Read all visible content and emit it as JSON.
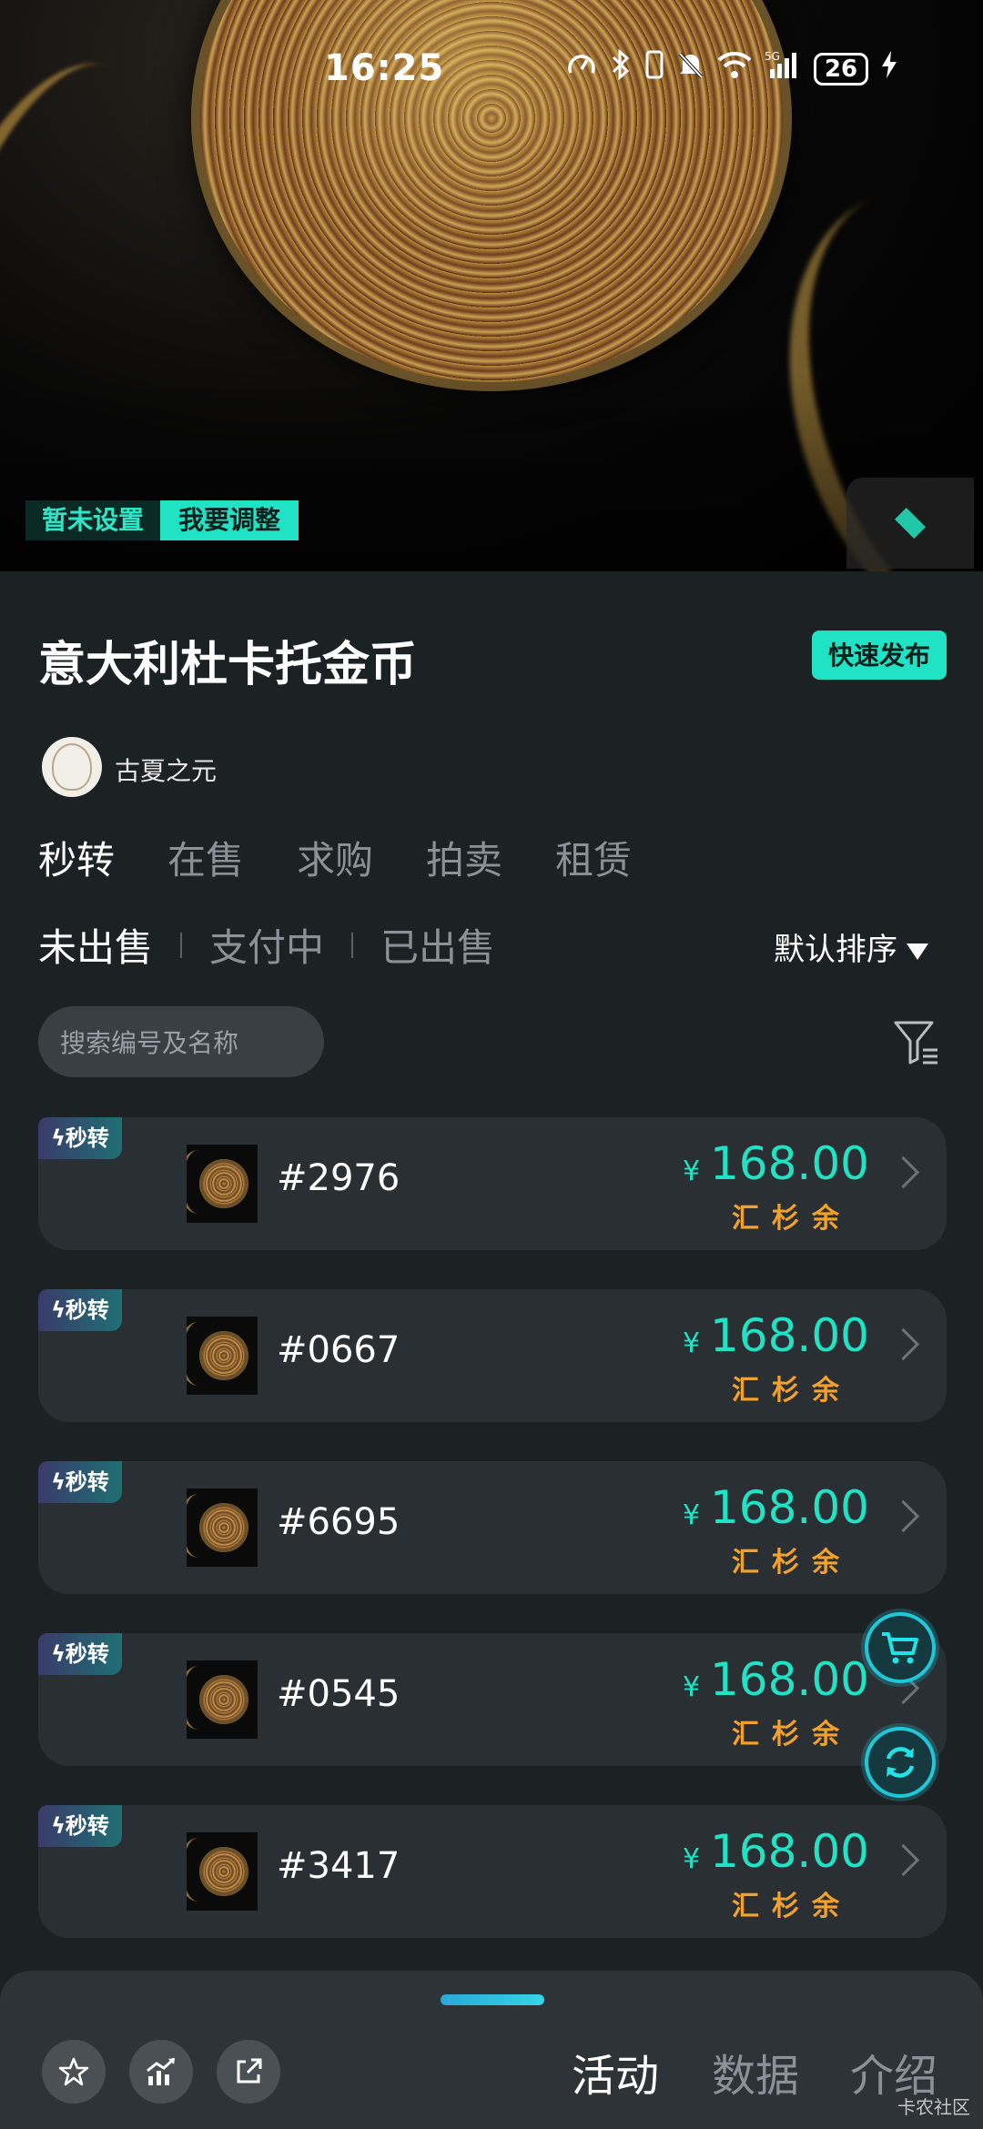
{
  "status_bar": {
    "time": "16:25",
    "network": "5G",
    "battery": "26"
  },
  "hero": {
    "tag_unset": "暂未设置",
    "tag_adjust": "我要调整"
  },
  "header": {
    "title": "意大利杜卡托金币",
    "quick_publish": "快速发布",
    "author": "古夏之元"
  },
  "main_tabs": [
    {
      "label": "秒转",
      "active": true
    },
    {
      "label": "在售",
      "active": false
    },
    {
      "label": "求购",
      "active": false
    },
    {
      "label": "拍卖",
      "active": false
    },
    {
      "label": "租赁",
      "active": false
    }
  ],
  "sub_tabs": [
    {
      "label": "未出售",
      "active": true
    },
    {
      "label": "支付中",
      "active": false
    },
    {
      "label": "已出售",
      "active": false
    }
  ],
  "sort_label": "默认排序",
  "search": {
    "placeholder": "搜索编号及名称"
  },
  "listings": [
    {
      "badge": "秒转",
      "code": "#2976",
      "yen": "¥",
      "price": "168.00",
      "currency": "汇杉余"
    },
    {
      "badge": "秒转",
      "code": "#0667",
      "yen": "¥",
      "price": "168.00",
      "currency": "汇杉余"
    },
    {
      "badge": "秒转",
      "code": "#6695",
      "yen": "¥",
      "price": "168.00",
      "currency": "汇杉余"
    },
    {
      "badge": "秒转",
      "code": "#0545",
      "yen": "¥",
      "price": "168.00",
      "currency": "汇杉余"
    },
    {
      "badge": "秒转",
      "code": "#3417",
      "yen": "¥",
      "price": "168.00",
      "currency": "汇杉余"
    }
  ],
  "bottom_bar": {
    "tabs": [
      {
        "label": "活动",
        "active": true
      },
      {
        "label": "数据",
        "active": false
      },
      {
        "label": "介绍",
        "active": false
      }
    ],
    "icons": [
      "star-icon",
      "chart-icon",
      "share-icon"
    ]
  },
  "watermark": "卡农社区",
  "colors": {
    "accent": "#1fe3c4",
    "currency": "#f3a12b",
    "background": "#1c2124",
    "card": "#2a2f33"
  }
}
